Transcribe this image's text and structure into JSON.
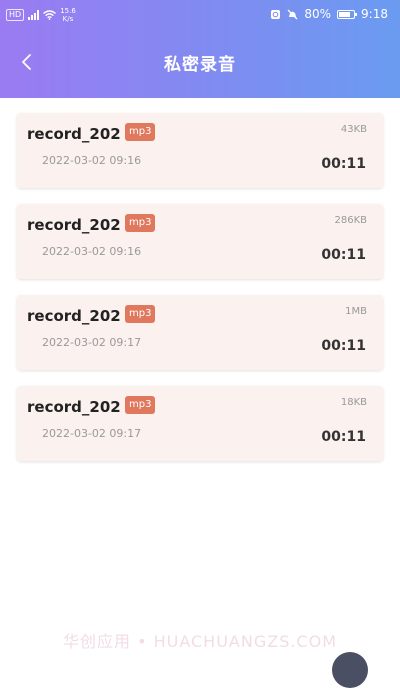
{
  "status_bar": {
    "hd": "HD",
    "net_speed_value": "15.6",
    "net_speed_unit": "K/s",
    "battery_percent": "80%",
    "battery_level": 0.8,
    "time": "9:18"
  },
  "header": {
    "title": "私密录音"
  },
  "recordings": [
    {
      "name": "record_202",
      "ext": "mp3",
      "size": "43KB",
      "date": "2022-03-02 09:16",
      "duration": "00:11"
    },
    {
      "name": "record_202",
      "ext": "mp3",
      "size": "286KB",
      "date": "2022-03-02 09:16",
      "duration": "00:11"
    },
    {
      "name": "record_202",
      "ext": "mp3",
      "size": "1MB",
      "date": "2022-03-02 09:17",
      "duration": "00:11"
    },
    {
      "name": "record_202",
      "ext": "mp3",
      "size": "18KB",
      "date": "2022-03-02 09:17",
      "duration": "00:11"
    }
  ],
  "watermark": "华创应用 • HUACHUANGZS.COM",
  "colors": {
    "header_gradient_start": "#9b7bf2",
    "header_gradient_end": "#6a9bf1",
    "card_background": "#fbf1ef",
    "ext_badge": "#e0785e"
  }
}
